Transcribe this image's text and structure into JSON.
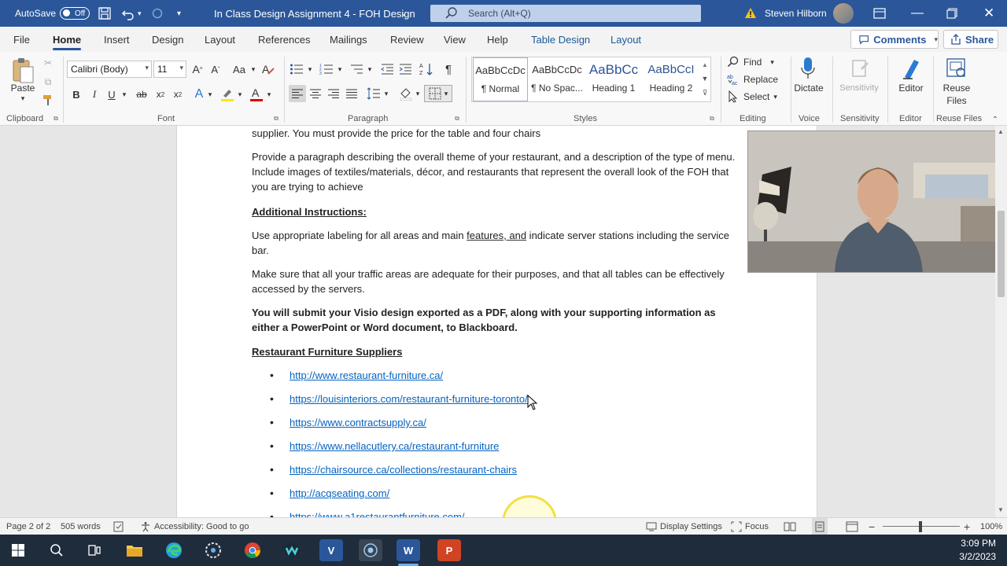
{
  "window": {
    "autosave_label": "AutoSave",
    "autosave_state": "Off",
    "doc_title": "In Class Design Assignment 4 - FOH Design",
    "search_placeholder": "Search (Alt+Q)",
    "user_name": "Steven Hilborn"
  },
  "tabs": [
    "File",
    "Home",
    "Insert",
    "Design",
    "Layout",
    "References",
    "Mailings",
    "Review",
    "View",
    "Help",
    "Table Design",
    "Layout"
  ],
  "actions": {
    "comments": "Comments",
    "share": "Share"
  },
  "ribbon": {
    "clipboard": {
      "paste": "Paste",
      "label": "Clipboard"
    },
    "font": {
      "family": "Calibri (Body)",
      "size": "11",
      "label": "Font",
      "aa": "Aa"
    },
    "paragraph": {
      "label": "Paragraph"
    },
    "styles": {
      "label": "Styles",
      "items": [
        {
          "preview": "AaBbCcDc",
          "name": "¶ Normal"
        },
        {
          "preview": "AaBbCcDc",
          "name": "¶ No Spac..."
        },
        {
          "preview": "AaBbCc",
          "name": "Heading 1"
        },
        {
          "preview": "AaBbCcI",
          "name": "Heading 2"
        }
      ]
    },
    "editing": {
      "find": "Find",
      "replace": "Replace",
      "select": "Select",
      "label": "Editing"
    },
    "voice": {
      "dictate": "Dictate",
      "label": "Voice"
    },
    "sensitivity": {
      "btn": "Sensitivity",
      "label": "Sensitivity"
    },
    "editor": {
      "btn": "Editor",
      "label": "Editor"
    },
    "reuse": {
      "btn1": "Reuse",
      "btn2": "Files",
      "label": "Reuse Files"
    }
  },
  "document": {
    "p0": "supplier. You must provide the price for the table and four chairs",
    "p1": "Provide a paragraph describing the overall theme of your restaurant, and a description of the type of menu. Include images of textiles/materials, décor, and restaurants that represent the overall look of the FOH that you are trying to achieve",
    "h_additional": "Additional Instructions:",
    "p2a": "Use appropriate labeling for all areas and main ",
    "p2b": "features, and",
    "p2c": " indicate server stations including the service bar.",
    "p3": "Make sure that all your traffic areas are adequate for their purposes, and that all tables can be effectively accessed by the servers.",
    "p4": "You will submit your Visio design exported as a PDF, along with your supporting information as either a PowerPoint or Word document, to Blackboard.",
    "h_suppliers": "Restaurant Furniture Suppliers",
    "links": [
      "http://www.restaurant-furniture.ca/",
      "https://louisinteriors.com/restaurant-furniture-toronto/",
      "https://www.contractsupply.ca/",
      "https://www.nellacutlery.ca/restaurant-furniture",
      "https://chairsource.ca/collections/restaurant-chairs",
      "http://acqseating.com/",
      "https://www.a1restaurantfurniture.com/"
    ]
  },
  "status": {
    "page": "Page 2 of 2",
    "words": "505 words",
    "accessibility": "Accessibility: Good to go",
    "display": "Display Settings",
    "focus": "Focus",
    "zoom": "100%"
  },
  "clock": {
    "time": "3:09 PM",
    "date": "3/2/2023"
  }
}
